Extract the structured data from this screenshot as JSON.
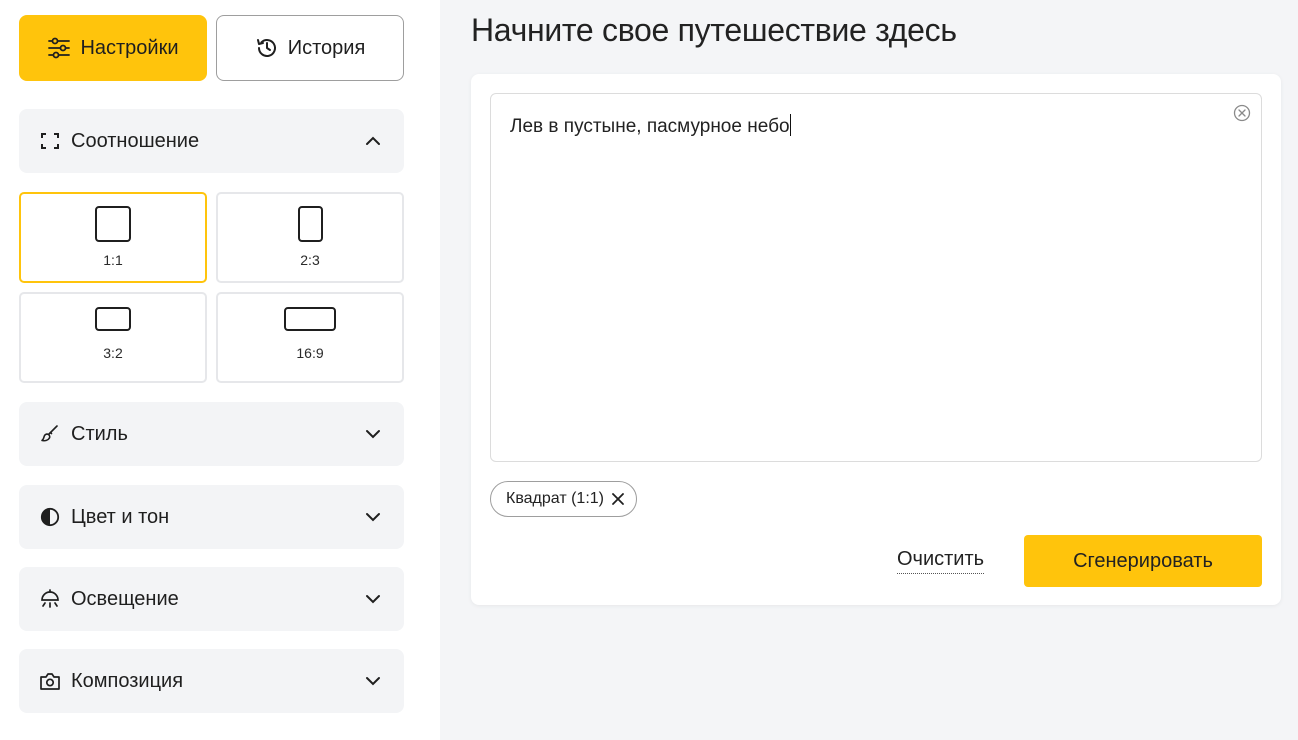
{
  "tabs": {
    "settings_label": "Настройки",
    "history_label": "История"
  },
  "aspect_section": {
    "label": "Соотношение",
    "options": [
      {
        "label": "1:1",
        "selected": true
      },
      {
        "label": "2:3",
        "selected": false
      },
      {
        "label": "3:2",
        "selected": false
      },
      {
        "label": "16:9",
        "selected": false
      }
    ]
  },
  "sections": {
    "style": "Стиль",
    "color_tone": "Цвет и тон",
    "lighting": "Освещение",
    "composition": "Композиция"
  },
  "main": {
    "title": "Начните свое путешествие здесь",
    "prompt_value": "Лев в пустыне, пасмурное небо",
    "chip_label": "Квадрат (1:1)",
    "clear_label": "Очистить",
    "generate_label": "Сгенерировать"
  },
  "colors": {
    "accent": "#ffc40c",
    "panel": "#f3f4f6",
    "background": "#f4f5f7"
  }
}
